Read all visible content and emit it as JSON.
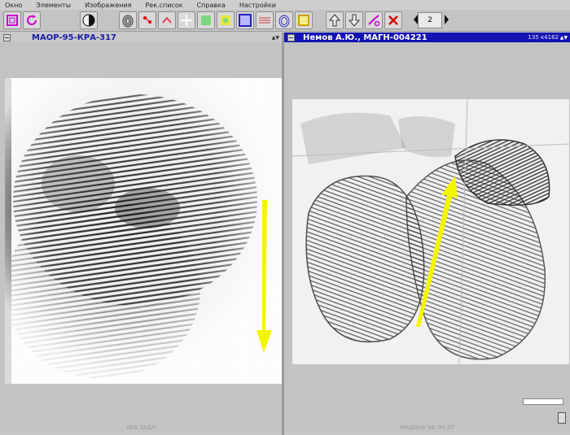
{
  "menu": {
    "items": [
      "Окно",
      "Элементы",
      "Изображения",
      "Рек.список",
      "Справка",
      "Настройки"
    ]
  },
  "toolbar": {
    "page_value": "2",
    "icons": [
      "select-frame-icon",
      "rotate-icon",
      "contrast-icon",
      "fingerprint-icon",
      "minutiae-red-icon",
      "minutiae-pink-icon",
      "crosshair-icon",
      "green-icon",
      "yellow-icon",
      "blue-frame-icon",
      "red-hatch-icon",
      "blue-fingerprint-icon",
      "yellow-frame-icon",
      "arrow-up-icon",
      "arrow-down-icon",
      "link-icon",
      "delete-icon"
    ]
  },
  "left_panel": {
    "title": "МАОР-95-КРА-317",
    "status": "ЛЕВ ЗАДН"
  },
  "right_panel": {
    "title": "Немов А.Ю., МАГН-004221",
    "meta": "135 к4162",
    "status": "МАДОНА 96 ЛН ЭТ"
  },
  "colors": {
    "accent_blue": "#1414b4",
    "arrow_yellow": "#f5f500",
    "background": "#c8c8c8"
  }
}
